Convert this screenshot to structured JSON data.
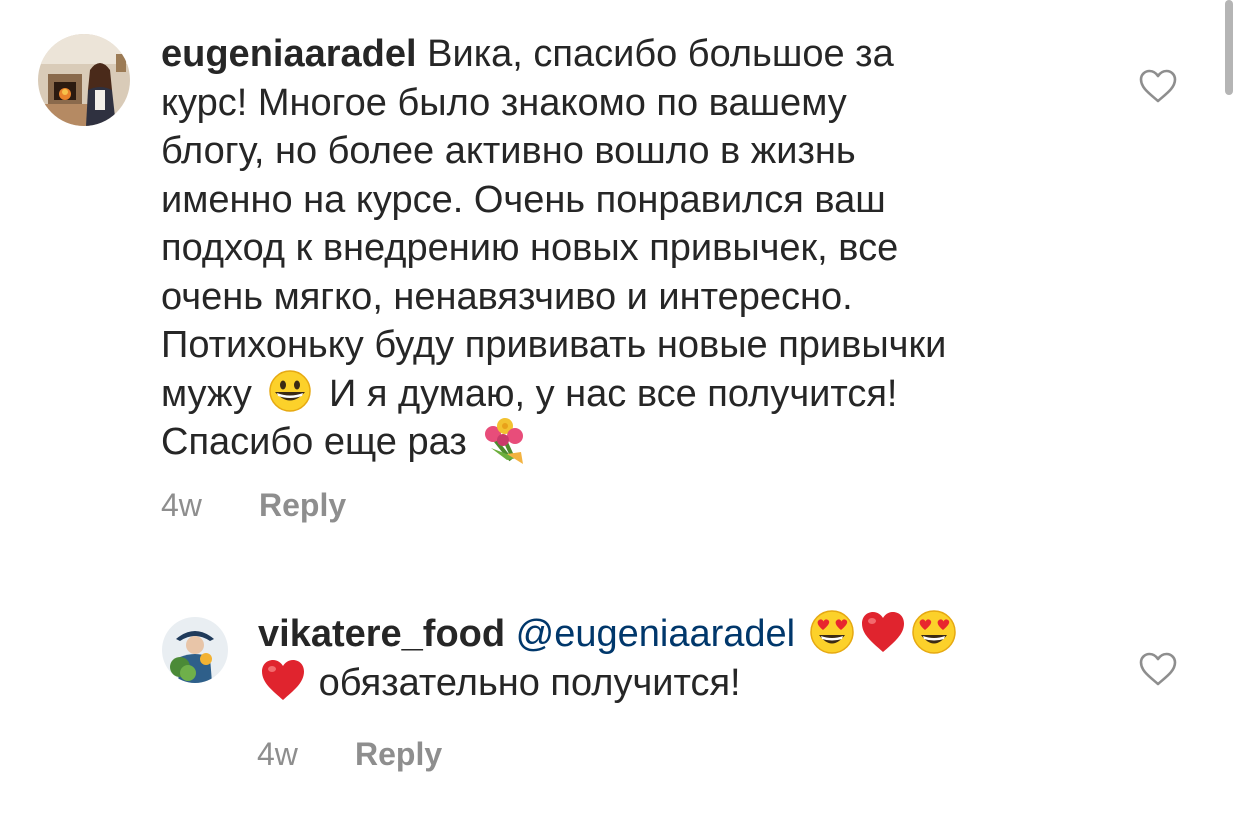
{
  "comments": [
    {
      "username": "eugeniaaradel",
      "lines": [
        "Вика, спасибо большое за",
        "курс! Многое было знакомо по вашему",
        "блогу, но более активно вошло в жизнь",
        "именно на курсе. Очень понравился ваш",
        "подход к внедрению новых привычек, все",
        "очень мягко, ненавязчиво и интересно.",
        "Потихоньку буду прививать новые привычки",
        "мужу",
        "И я думаю, у нас все получится!",
        "Спасибо еще раз"
      ],
      "time": "4w",
      "reply_label": "Reply",
      "icons": [
        "grinning-face-emoji",
        "bouquet-emoji",
        "heart-outline-icon"
      ]
    },
    {
      "username": "vikatere_food",
      "mention": "@eugeniaaradel",
      "text": "обязательно получится!",
      "time": "4w",
      "reply_label": "Reply",
      "icons": [
        "heart-eyes-emoji",
        "red-heart-emoji",
        "heart-eyes-emoji",
        "red-heart-emoji",
        "heart-outline-icon"
      ]
    }
  ],
  "colors": {
    "text": "#262626",
    "meta": "#8e8e8e",
    "mention": "#00376b",
    "heart": "#e0242e"
  }
}
